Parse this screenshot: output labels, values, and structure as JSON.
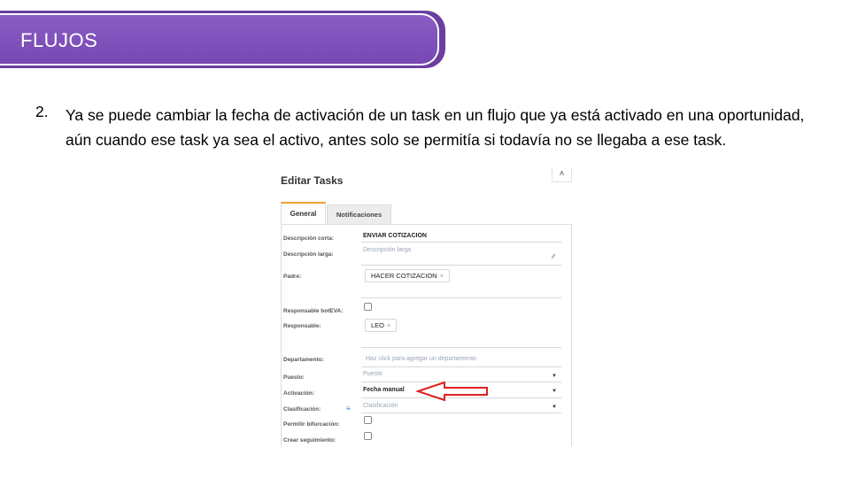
{
  "header": {
    "title": "FLUJOS"
  },
  "item": {
    "number": "2.",
    "text": "Ya se puede cambiar la fecha de activación de un task en un flujo que ya está activado en una oportunidad, aún cuando ese task ya sea el activo, antes solo se permitía si todavía no se llegaba a ese task."
  },
  "screenshot": {
    "title": "Editar Tasks",
    "collapse_glyph": "˄",
    "tabs": [
      {
        "label": "General"
      },
      {
        "label": "Notificaciones"
      }
    ],
    "fields": {
      "desc_corta_label": "Descripción corta:",
      "desc_corta_value": "ENVIAR COTIZACION",
      "desc_larga_label": "Descripción larga:",
      "desc_larga_placeholder": "Descripción larga",
      "padre_label": "Padre:",
      "padre_value": "HACER COTIZACION",
      "resp_bot_label": "Responsable botEVA:",
      "responsable_label": "Responsable:",
      "responsable_value": "LEO",
      "departamento_label": "Departamento:",
      "departamento_placeholder": "Haz click para agregar un departamento",
      "puesto_label": "Puesto:",
      "puesto_placeholder": "Puesto",
      "activacion_label": "Activación:",
      "activacion_value": "Fecha manual",
      "clasificacion_label": "Clasificación:",
      "clasificacion_placeholder": "Clasificación",
      "bifurcacion_label": "Permitir bifurcación:",
      "seguimiento_label": "Crear seguimiento:"
    },
    "chip_remove_glyph": "×",
    "caret_glyph": "▼",
    "list_icon_glyph": "≡",
    "resize_glyph": "⁄⁄"
  },
  "annotation": {
    "arrow_color": "#e02020"
  },
  "colors": {
    "banner": "#7748b3",
    "tab_accent": "#f0a030"
  }
}
